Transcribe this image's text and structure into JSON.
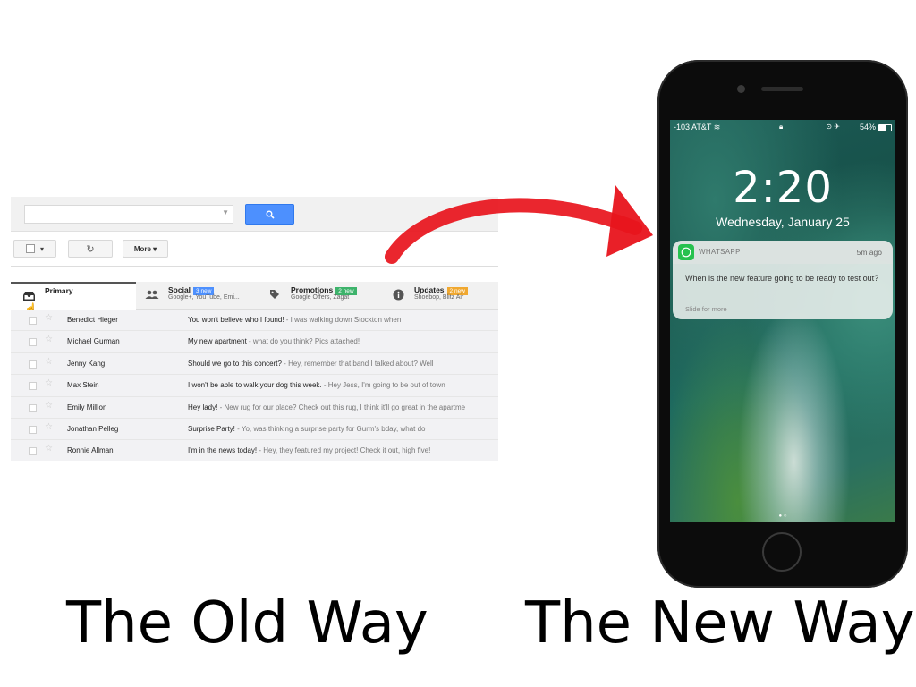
{
  "gmail": {
    "more_label": "More ▾",
    "tabs": [
      {
        "title": "Primary",
        "subtitle": "",
        "badge": "",
        "badge_color": ""
      },
      {
        "title": "Social",
        "subtitle": "Google+, YouTube, Emi...",
        "badge": "3 new",
        "badge_color": "#4d90fe"
      },
      {
        "title": "Promotions",
        "subtitle": "Google Offers, Zagat",
        "badge": "2 new",
        "badge_color": "#3db36b"
      },
      {
        "title": "Updates",
        "subtitle": "Shoebop, Blitz Air",
        "badge": "2 new",
        "badge_color": "#f0a830"
      }
    ],
    "rows": [
      {
        "sender": "Benedict Hieger",
        "subject": "You won't believe who I found!",
        "snippet": " - I was walking down Stockton when"
      },
      {
        "sender": "Michael Gurman",
        "subject": "My new apartment",
        "snippet": " - what do you think? Pics attached!"
      },
      {
        "sender": "Jenny Kang",
        "subject": "Should we go to this concert?",
        "snippet": " - Hey, remember that band I talked about? Well"
      },
      {
        "sender": "Max Stein",
        "subject": "I won't be able to walk your dog this week.",
        "snippet": " - Hey Jess, I'm going to be out of town"
      },
      {
        "sender": "Emily Million",
        "subject": "Hey lady!",
        "snippet": " - New rug for our place? Check out this rug, I think it'll go great in the apartme"
      },
      {
        "sender": "Jonathan Pelleg",
        "subject": "Surprise Party!",
        "snippet": " - Yo, was thinking a surprise party for Gurm's bday, what do"
      },
      {
        "sender": "Ronnie Allman",
        "subject": "I'm in the news today!",
        "snippet": " - Hey, they featured my project! Check it out, high five!"
      }
    ]
  },
  "phone": {
    "carrier": "-103 AT&T",
    "battery": "54%",
    "time": "2:20",
    "date": "Wednesday, January 25",
    "notification": {
      "app": "WHATSAPP",
      "age": "5m ago",
      "message": "When is the new feature going to be ready to test out?",
      "action": "Slide for more"
    }
  },
  "captions": {
    "left": "The Old Way",
    "right": "The New Way"
  },
  "colors": {
    "search_button": "#4d90fe",
    "arrow": "#e8141c",
    "whatsapp": "#26c14e"
  }
}
